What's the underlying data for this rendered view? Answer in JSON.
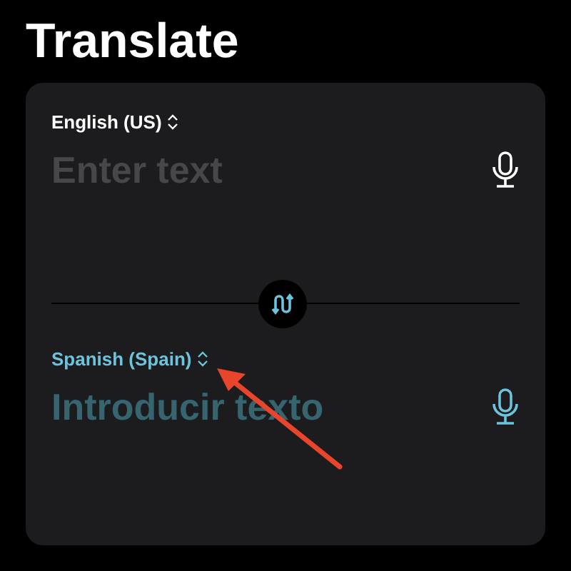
{
  "title": "Translate",
  "panels": [
    {
      "kind": "source",
      "language": "English (US)",
      "placeholder": "Enter text"
    },
    {
      "kind": "target",
      "language": "Spanish (Spain)",
      "placeholder": "Introducir texto"
    }
  ],
  "annotations": [
    {
      "kind": "arrow"
    }
  ]
}
